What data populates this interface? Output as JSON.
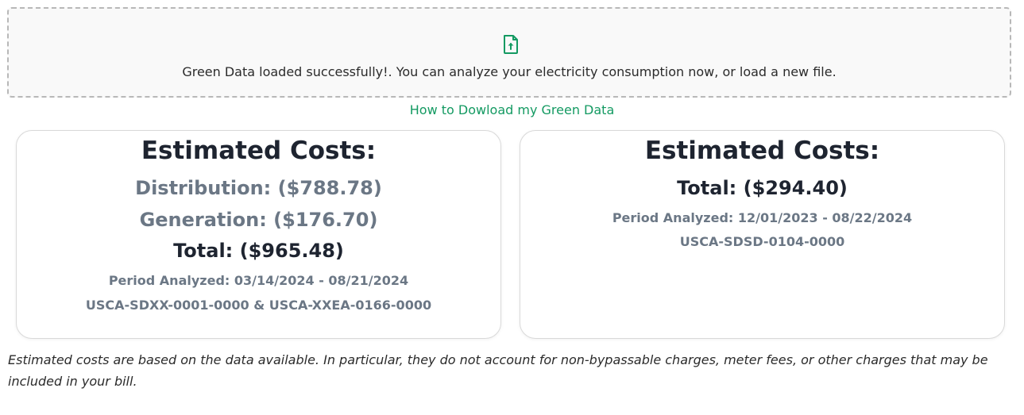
{
  "upload": {
    "icon": "file-upload-icon",
    "message": "Green Data loaded successfully!. You can analyze your electricity consumption now, or load a new file."
  },
  "help_link": "How to Dowload my Green Data",
  "colors": {
    "accent": "#149a62",
    "title": "#1e2430",
    "muted": "#6b7785"
  },
  "cards": [
    {
      "title": "Estimated Costs:",
      "distribution": "Distribution: ($788.78)",
      "generation": "Generation: ($176.70)",
      "total": "Total: ($965.48)",
      "period": "Period Analyzed: 03/14/2024 - 08/21/2024",
      "rates": "USCA-SDXX-0001-0000 & USCA-XXEA-0166-0000"
    },
    {
      "title": "Estimated Costs:",
      "total": "Total: ($294.40)",
      "period": "Period Analyzed: 12/01/2023 - 08/22/2024",
      "rates": "USCA-SDSD-0104-0000"
    }
  ],
  "disclaimer": "Estimated costs are based on the data available. In particular, they do not account for non-bypassable charges, meter fees, or other charges that may be included in your bill."
}
